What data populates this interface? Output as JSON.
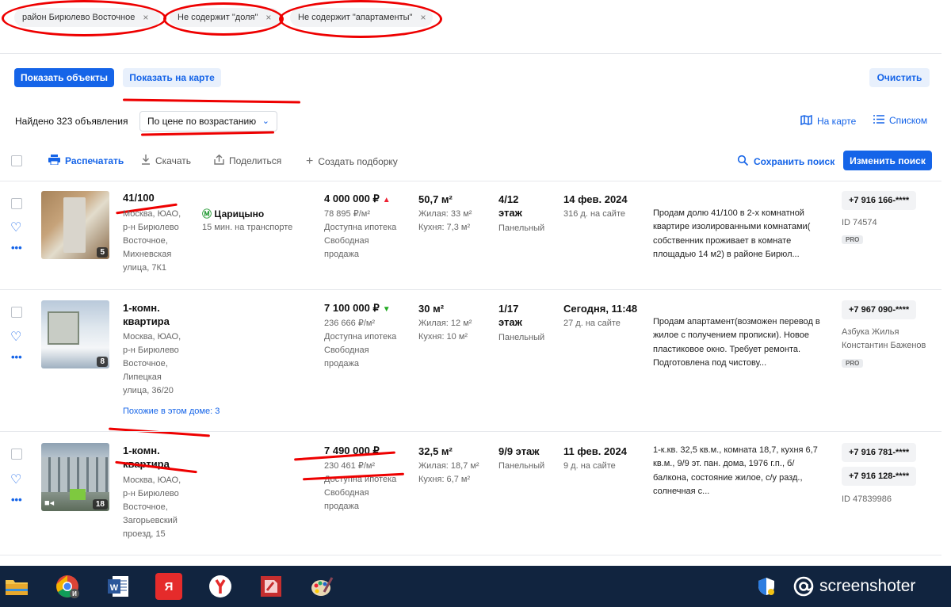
{
  "filters": [
    {
      "label": "район Бирюлево Восточное"
    },
    {
      "label": "Не содержит \"доля\""
    },
    {
      "label": "Не содержит \"апартаменты\""
    }
  ],
  "actions": {
    "show_objects": "Показать объекты",
    "show_on_map": "Показать на карте",
    "clear": "Очистить"
  },
  "results": {
    "found": "Найдено 323 объявления",
    "sort": "По цене по возрастанию",
    "on_map": "На карте",
    "list": "Списком"
  },
  "toolbar": {
    "print": "Распечатать",
    "download": "Скачать",
    "share": "Поделиться",
    "create_selection": "Создать подборку",
    "save_search": "Сохранить поиск",
    "change_search": "Изменить поиск"
  },
  "listings": [
    {
      "photos": "5",
      "title": "41/100",
      "address": [
        "Москва, ЮАО,",
        "р-н Бирюлево",
        "Восточное,",
        "Михневская",
        "улица, 7К1"
      ],
      "metro": "Царицыно",
      "metro_time": "15 мин. на транспорте",
      "price": "4 000 000 ₽",
      "price_trend": "up",
      "price_per_m": "78 895 ₽/м²",
      "mortgage": "Доступна ипотека",
      "sale_type": [
        "Свободная",
        "продажа"
      ],
      "area": "50,7 м²",
      "living": "Жилая: 33 м²",
      "kitchen": "Кухня: 7,3 м²",
      "floor": [
        "4/12",
        "этаж"
      ],
      "house": "Панельный",
      "date": "14 фев. 2024",
      "on_site": "316 д. на сайте",
      "description": "Продам долю 41/100 в 2-х комнатной квартире изолированными комнатами( собственник проживает в комнате площадью 14 м2) в районе Бирюл...",
      "phones": [
        "+7 916 166-****"
      ],
      "agent_id": "ID 74574",
      "badge": "PRO"
    },
    {
      "photos": "8",
      "title": "1-комн. квартира",
      "address": [
        "Москва, ЮАО,",
        "р-н Бирюлево",
        "Восточное,",
        "Липецкая",
        "улица, 36/20"
      ],
      "similar": "Похожие в этом доме: 3",
      "price": "7 100 000 ₽",
      "price_trend": "down",
      "price_per_m": "236 666 ₽/м²",
      "mortgage": "Доступна ипотека",
      "sale_type": [
        "Свободная",
        "продажа"
      ],
      "area": "30 м²",
      "living": "Жилая: 12 м²",
      "kitchen": "Кухня: 10 м²",
      "floor": [
        "1/17",
        "этаж"
      ],
      "house": "Панельный",
      "date": "Сегодня, 11:48",
      "on_site": "27 д. на сайте",
      "description": "Продам апартамент(возможен перевод в жилое с получением прописки). Новое пластиковое окно. Требует ремонта. Подготовлена под чистову...",
      "phones": [
        "+7 967 090-****"
      ],
      "agency": [
        "Азбука Жилья",
        "Константин Баженов"
      ],
      "badge": "PRO"
    },
    {
      "photos": "18",
      "title": "1-комн. квартира",
      "address": [
        "Москва, ЮАО,",
        "р-н Бирюлево",
        "Восточное,",
        "Загорьевский",
        "проезд, 15"
      ],
      "price": "7 490 000 ₽",
      "price_per_m": "230 461 ₽/м²",
      "mortgage": "Доступна ипотека",
      "sale_type": [
        "Свободная",
        "продажа"
      ],
      "area": "32,5 м²",
      "living": "Жилая: 18,7 м²",
      "kitchen": "Кухня: 6,7 м²",
      "floor": [
        "9/9 этаж"
      ],
      "house": "Панельный",
      "date": "11 фев. 2024",
      "on_site": "9 д. на сайте",
      "description": "1-к.кв. 32,5 кв.м., комната 18,7, кухня 6,7 кв.м., 9/9 эт. пан. дома, 1976 г.п., б/балкона, состояние жилое, с/у разд., солнечная с...",
      "phones": [
        "+7 916 781-****",
        "+7 916 128-****"
      ],
      "agent_id": "ID 47839986"
    }
  ],
  "taskbar": {
    "brand": "screenshoter"
  }
}
